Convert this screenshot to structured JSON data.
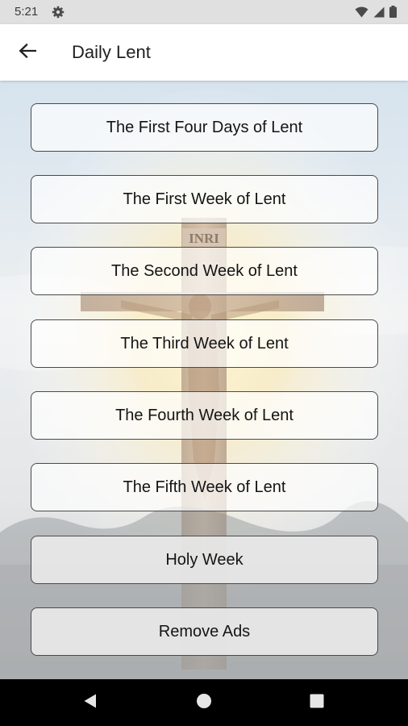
{
  "status_bar": {
    "time": "5:21",
    "icons": [
      "gear-icon",
      "wifi-icon",
      "signal-icon",
      "battery-icon"
    ]
  },
  "app_bar": {
    "back_icon": "arrow-left-icon",
    "title": "Daily Lent"
  },
  "menu": {
    "items": [
      {
        "label": "The First Four Days of Lent"
      },
      {
        "label": "The First Week of Lent"
      },
      {
        "label": "The Second Week of Lent"
      },
      {
        "label": "The Third Week of Lent"
      },
      {
        "label": "The Fourth Week of Lent"
      },
      {
        "label": "The Fifth Week of Lent"
      },
      {
        "label": "Holy Week"
      },
      {
        "label": "Remove Ads"
      }
    ]
  },
  "background": {
    "cross_inscription": "INRI"
  },
  "nav_bar": {
    "icons": [
      "back-triangle-icon",
      "home-circle-icon",
      "recents-square-icon"
    ]
  },
  "colors": {
    "status_bar": "#e0e0e0",
    "app_bar": "#ffffff",
    "button_border": "#4a4a4a",
    "nav_bar": "#000000"
  }
}
